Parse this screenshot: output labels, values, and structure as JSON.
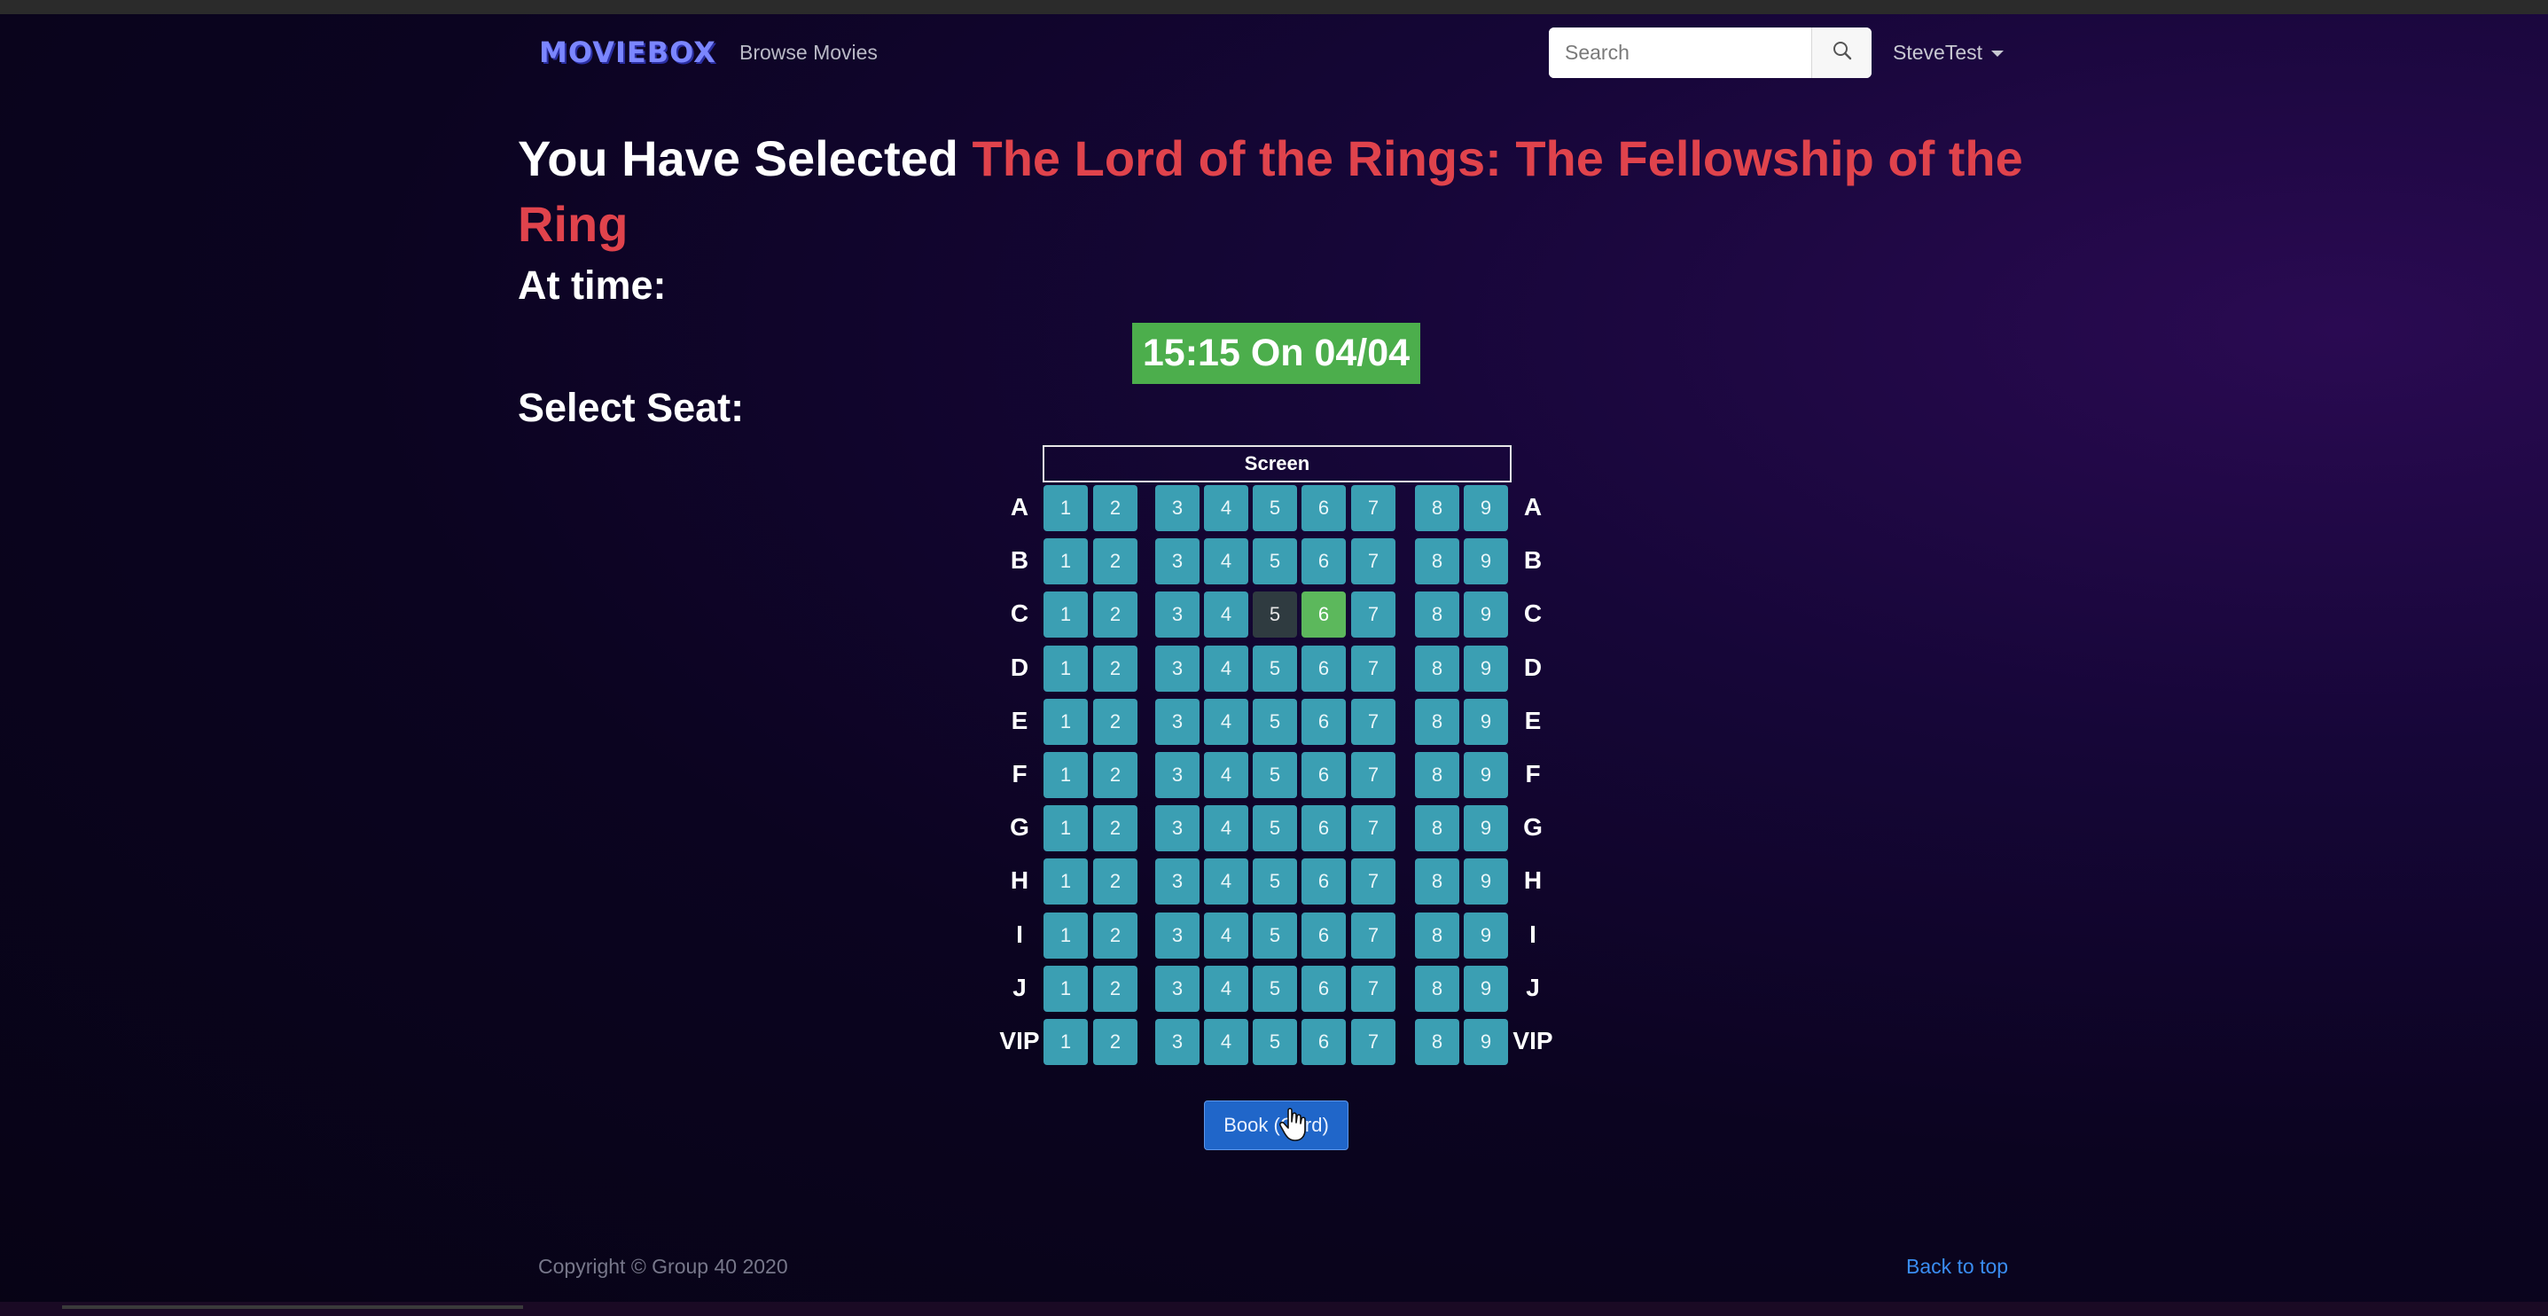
{
  "navbar": {
    "logo": "MOVIEBOX",
    "browse_label": "Browse Movies",
    "search_placeholder": "Search",
    "user_label": "SteveTest"
  },
  "heading": {
    "prefix": "You Have Selected ",
    "movie_title": "The Lord of the Rings: The Fellowship of the Ring"
  },
  "showtime": {
    "label": "At time:",
    "value": "15:15 On 04/04"
  },
  "seating": {
    "label": "Select Seat:",
    "screen_label": "Screen",
    "rows": [
      "A",
      "B",
      "C",
      "D",
      "E",
      "F",
      "G",
      "H",
      "I",
      "J",
      "VIP"
    ],
    "seat_numbers": [
      "1",
      "2",
      "3",
      "4",
      "5",
      "6",
      "7",
      "8",
      "9"
    ],
    "taken": [
      {
        "row": "C",
        "seat": "5"
      }
    ],
    "selected": [
      {
        "row": "C",
        "seat": "6"
      }
    ]
  },
  "book_button": "Book (Card)",
  "footer": {
    "copyright": "Copyright © Group 40 2020",
    "back_to_top": "Back to top"
  },
  "colors": {
    "accent_title": "#e0434c",
    "seat_available": "#3b9fb3",
    "seat_taken": "#2f3b40",
    "seat_selected": "#5cb85c",
    "time_badge": "#4cae4c",
    "book_button": "#2066c9"
  }
}
